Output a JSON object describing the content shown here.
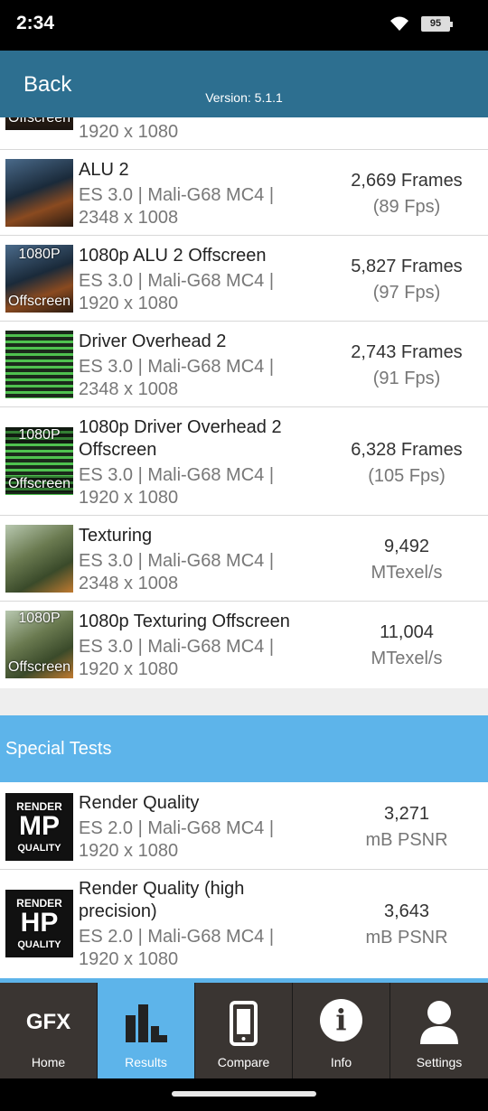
{
  "status": {
    "time": "2:34",
    "battery": "95"
  },
  "header": {
    "back": "Back",
    "version": "Version: 5.1.1"
  },
  "partial_row": {
    "badge": "Offscreen",
    "sub": "1920 x 1080"
  },
  "rows": [
    {
      "name": "ALU 2",
      "sub1": "ES 3.0 | Mali-G68 MC4 |",
      "sub2": "2348 x 1008",
      "score": "2,669 Frames",
      "unit": "(89 Fps)"
    },
    {
      "name": "1080p ALU 2 Offscreen",
      "sub1": "ES 3.0 | Mali-G68 MC4 |",
      "sub2": "1920 x 1080",
      "score": "5,827 Frames",
      "unit": "(97 Fps)",
      "badge_top": "1080P",
      "badge_bottom": "Offscreen"
    },
    {
      "name": "Driver Overhead 2",
      "sub1": "ES 3.0 | Mali-G68 MC4 |",
      "sub2": "2348 x 1008",
      "score": "2,743 Frames",
      "unit": "(91 Fps)"
    },
    {
      "name": "1080p Driver Overhead 2",
      "name2": "Offscreen",
      "sub1": "ES 3.0 | Mali-G68 MC4 |",
      "sub2": "1920 x 1080",
      "score": "6,328 Frames",
      "unit": "(105 Fps)",
      "badge_top": "1080P",
      "badge_bottom": "Offscreen"
    },
    {
      "name": "Texturing",
      "sub1": "ES 3.0 | Mali-G68 MC4 |",
      "sub2": "2348 x 1008",
      "score": "9,492",
      "unit": "MTexel/s"
    },
    {
      "name": "1080p Texturing Offscreen",
      "sub1": "ES 3.0 | Mali-G68 MC4 |",
      "sub2": "1920 x 1080",
      "score": "11,004",
      "unit": "MTexel/s",
      "badge_top": "1080P",
      "badge_bottom": "Offscreen"
    }
  ],
  "section": {
    "title": "Special Tests"
  },
  "special": [
    {
      "name": "Render Quality",
      "sub1": "ES 2.0 | Mali-G68 MC4 |",
      "sub2": "1920 x 1080",
      "score": "3,271",
      "unit": "mB PSNR",
      "logo_top": "RENDER",
      "logo_mid": "MP",
      "logo_bottom": "QUALITY"
    },
    {
      "name": "Render Quality (high",
      "name2": "precision)",
      "sub1": "ES 2.0 | Mali-G68 MC4 |",
      "sub2": "1920 x 1080",
      "score": "3,643",
      "unit": "mB PSNR",
      "logo_top": "RENDER",
      "logo_mid": "HP",
      "logo_bottom": "QUALITY"
    }
  ],
  "tabs": [
    {
      "label": "Home",
      "icon": "gfx-logo",
      "logo_text": "GFX"
    },
    {
      "label": "Results",
      "icon": "bar-chart-icon"
    },
    {
      "label": "Compare",
      "icon": "phone-icon"
    },
    {
      "label": "Info",
      "icon": "info-icon",
      "glyph": "i"
    },
    {
      "label": "Settings",
      "icon": "user-icon"
    }
  ],
  "colors": {
    "header": "#2d6f90",
    "accent": "#5db4ea",
    "tabbar": "#3a3532"
  }
}
